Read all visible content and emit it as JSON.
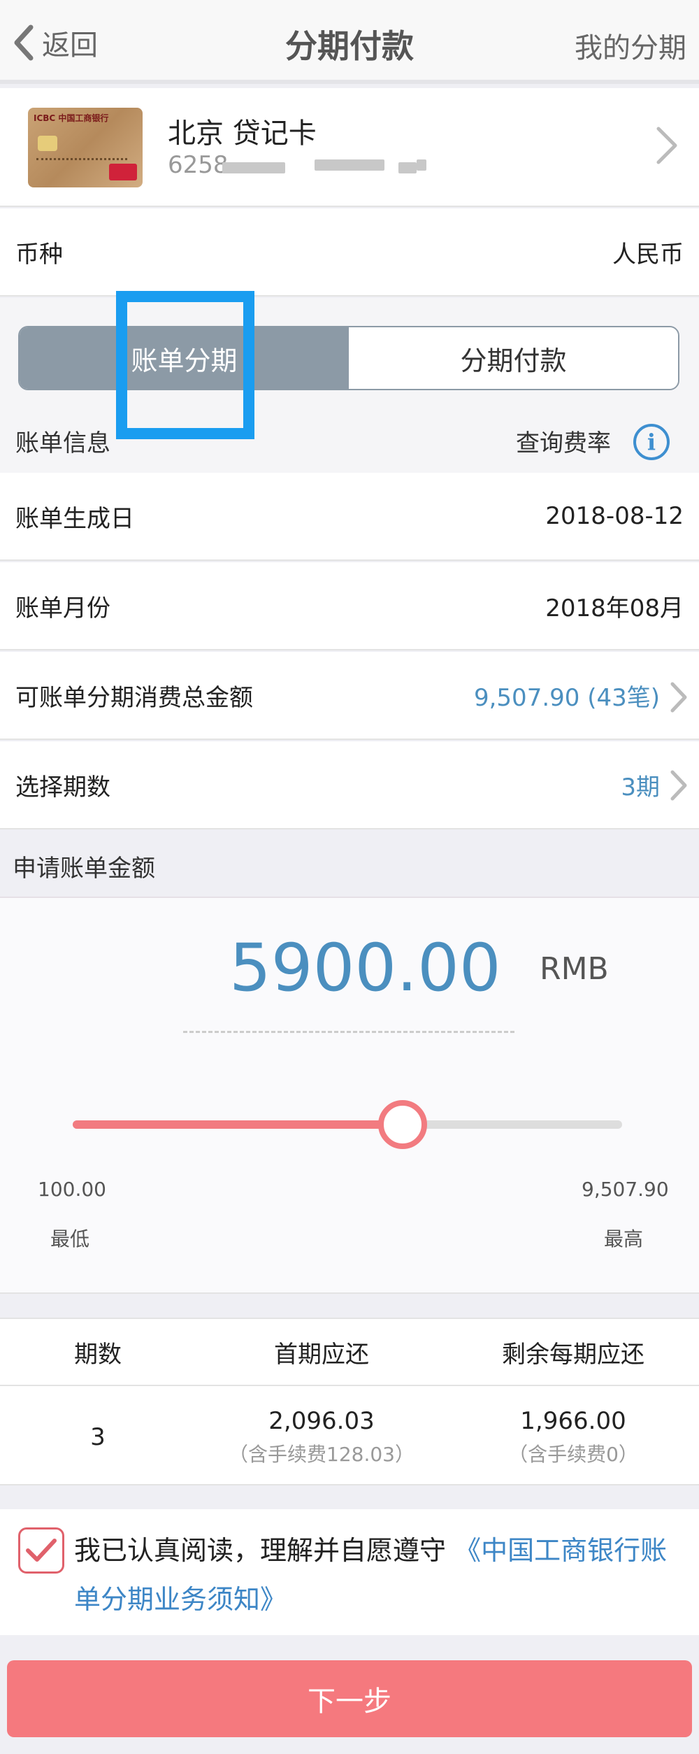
{
  "header": {
    "back_label": "返回",
    "title": "分期付款",
    "right_label": "我的分期"
  },
  "card": {
    "bank_text": "ICBC 中国工商银行",
    "name": "北京 贷记卡",
    "number_prefix": "6258"
  },
  "currency": {
    "label": "币种",
    "value": "人民币"
  },
  "tabs": [
    {
      "label": "账单分期",
      "active": true
    },
    {
      "label": "分期付款",
      "active": false
    }
  ],
  "bill_info": {
    "label": "账单信息",
    "rate_label": "查询费率",
    "info_icon": "i"
  },
  "rows": [
    {
      "label": "账单生成日",
      "value": "2018-08-12"
    },
    {
      "label": "账单月份",
      "value": "2018年08月"
    },
    {
      "label": "可账单分期消费总金额",
      "value": "9,507.90 (43笔)"
    },
    {
      "label": "选择期数",
      "value": "3期"
    }
  ],
  "apply": {
    "label": "申请账单金额",
    "amount": "5900.00",
    "currency": "RMB",
    "slider_fraction": 0.6,
    "min_value": "100.00",
    "min_label": "最低",
    "max_value": "9,507.90",
    "max_label": "最高"
  },
  "table": {
    "headers": [
      "期数",
      "首期应还",
      "剩余每期应还"
    ],
    "periods": "3",
    "first_payment": "2,096.03",
    "first_fee_note": "（含手续费128.03）",
    "remaining_payment": "1,966.00",
    "remaining_fee_note": "（含手续费0）"
  },
  "agreement": {
    "text": "我已认真阅读，理解并自愿遵守",
    "link": "《中国工商银行账单分期业务须知》",
    "checked": true
  },
  "next_button": "下一步",
  "colors": {
    "accent_blue": "#4b8fbf",
    "accent_red": "#f5797e",
    "segment_gray": "#8c9aa6",
    "highlight": "#1a9df0"
  }
}
